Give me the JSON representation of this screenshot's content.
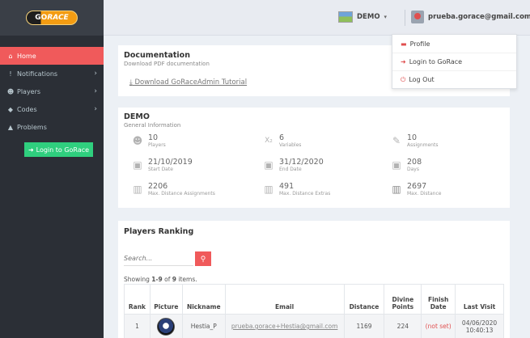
{
  "sidebar": {
    "logo": {
      "part1": "GO",
      "part2": "RACE"
    },
    "items": [
      {
        "label": "Home",
        "icon": "home-icon",
        "glyph": "⌂",
        "active": true,
        "chevron": ""
      },
      {
        "label": "Notifications",
        "icon": "exclamation-icon",
        "glyph": "!",
        "active": false,
        "chevron": "›"
      },
      {
        "label": "Players",
        "icon": "users-icon",
        "glyph": "☻",
        "active": false,
        "chevron": "›"
      },
      {
        "label": "Codes",
        "icon": "tag-icon",
        "glyph": "◆",
        "active": false,
        "chevron": "›"
      },
      {
        "label": "Problems",
        "icon": "warning-icon",
        "glyph": "▲",
        "active": false,
        "chevron": ""
      }
    ],
    "login_button": "Login to GoRace"
  },
  "topbar": {
    "org": "DEMO",
    "user_email": "prueba.gorace@gmail.com"
  },
  "dropdown": {
    "items": [
      {
        "label": "Profile",
        "icon": "id-card-icon",
        "glyph": "▬"
      },
      {
        "label": "Login to GoRace",
        "icon": "sign-in-icon",
        "glyph": "➜"
      },
      {
        "label": "Log Out",
        "icon": "power-icon",
        "glyph": "⏻"
      }
    ]
  },
  "documentation": {
    "title": "Documentation",
    "subtitle": "Download PDF documentation",
    "link": "Download GoRaceAdmin Tutorial",
    "link_icon_glyph": "⤓"
  },
  "demo": {
    "title": "DEMO",
    "subtitle": "General Information",
    "stats": [
      {
        "value": "10",
        "label": "Players",
        "icon": "users-icon",
        "glyph": "☻"
      },
      {
        "value": "6",
        "label": "Variables",
        "icon": "subscript-icon",
        "glyph": "X₂"
      },
      {
        "value": "10",
        "label": "Assignments",
        "icon": "edit-icon",
        "glyph": "✎"
      },
      {
        "value": "21/10/2019",
        "label": "Start Date",
        "icon": "calendar-check-icon",
        "glyph": "▣"
      },
      {
        "value": "31/12/2020",
        "label": "End Date",
        "icon": "calendar-x-icon",
        "glyph": "▣"
      },
      {
        "value": "208",
        "label": "Days",
        "icon": "calendar-icon",
        "glyph": "▣"
      },
      {
        "value": "2206",
        "label": "Max. Distance Assignments",
        "icon": "map-icon",
        "glyph": "▥"
      },
      {
        "value": "491",
        "label": "Max. Distance Extras",
        "icon": "map-icon",
        "glyph": "▥"
      },
      {
        "value": "2697",
        "label": "Max. Distance",
        "icon": "map-filled-icon",
        "glyph": "▥"
      }
    ]
  },
  "ranking": {
    "title": "Players Ranking",
    "search_placeholder": "Search...",
    "showing_prefix": "Showing ",
    "showing_range": "1-9",
    "showing_of": " of ",
    "showing_total": "9",
    "showing_suffix": " items.",
    "columns": [
      "Rank",
      "Picture",
      "Nickname",
      "Email",
      "Distance",
      "Divine Points",
      "Finish Date",
      "Last Visit"
    ],
    "rows": [
      {
        "rank": "1",
        "nickname": "Hestia_P",
        "email": "prueba.gorace+Hestia@gmail.com",
        "distance": "1169",
        "divine_points": "224",
        "finish_date": "(not set)",
        "last_visit": "04/06/2020 10:40:13"
      }
    ]
  }
}
